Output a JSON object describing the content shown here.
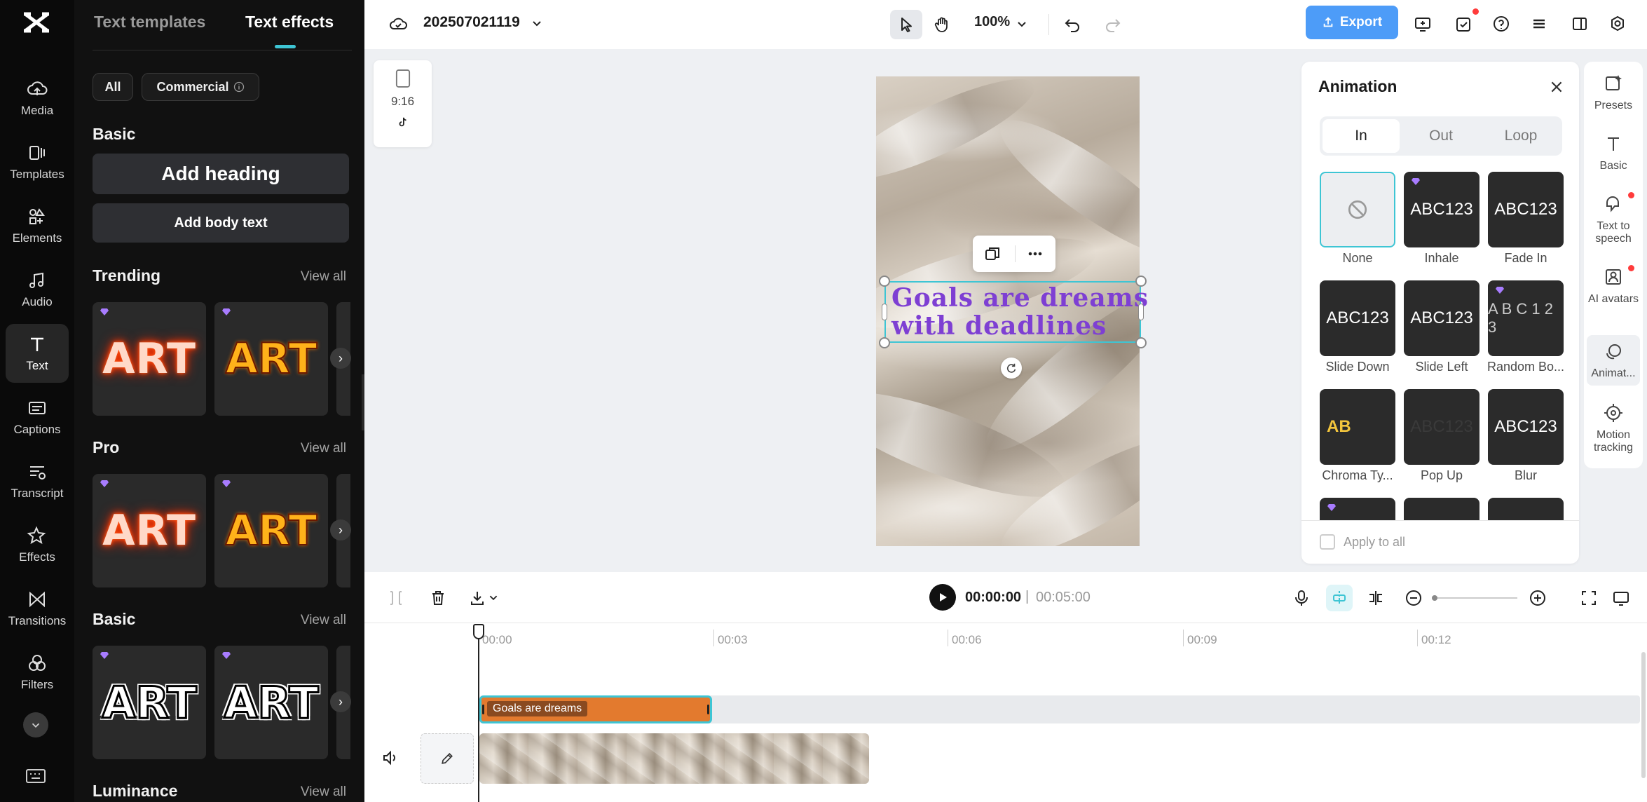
{
  "rail": {
    "items": [
      {
        "label": "Media",
        "icon": "cloud-upload-icon"
      },
      {
        "label": "Templates",
        "icon": "templates-icon"
      },
      {
        "label": "Elements",
        "icon": "elements-icon"
      },
      {
        "label": "Audio",
        "icon": "music-note-icon"
      },
      {
        "label": "Text",
        "icon": "text-icon"
      },
      {
        "label": "Captions",
        "icon": "captions-icon"
      },
      {
        "label": "Transcript",
        "icon": "transcript-icon"
      },
      {
        "label": "Effects",
        "icon": "effects-icon"
      },
      {
        "label": "Transitions",
        "icon": "transitions-icon"
      },
      {
        "label": "Filters",
        "icon": "filters-icon"
      }
    ],
    "active": "Text"
  },
  "panel": {
    "tabs": [
      "Text templates",
      "Text effects"
    ],
    "active_tab": "Text effects",
    "chips": {
      "all": "All",
      "commercial": "Commercial"
    },
    "basic_title": "Basic",
    "add_heading": "Add heading",
    "add_body": "Add body text",
    "sections": [
      {
        "title": "Trending",
        "view_all": "View all"
      },
      {
        "title": "Pro",
        "view_all": "View all"
      },
      {
        "title": "Basic",
        "view_all": "View all"
      },
      {
        "title": "Luminance",
        "view_all": "View all"
      }
    ],
    "card_text": "ART"
  },
  "topbar": {
    "project_name": "202507021119",
    "zoom": "100%",
    "export_label": "Export"
  },
  "canvas": {
    "ratio": "9:16",
    "text_line1": "Goals are dreams",
    "text_line2": "with deadlines"
  },
  "animation": {
    "title": "Animation",
    "tabs": [
      "In",
      "Out",
      "Loop"
    ],
    "active_tab": "In",
    "items": [
      {
        "label": "None",
        "preview": "",
        "selected": true,
        "pro": false
      },
      {
        "label": "Inhale",
        "preview": "ABC123",
        "pro": true
      },
      {
        "label": "Fade In",
        "preview": "ABC123",
        "pro": false
      },
      {
        "label": "Slide Down",
        "preview": "ABC123",
        "pro": false
      },
      {
        "label": "Slide Left",
        "preview": "ABC123",
        "pro": false
      },
      {
        "label": "Random Bo...",
        "preview": "A B C 1 2 3",
        "pro": true
      },
      {
        "label": "Chroma Ty...",
        "preview": "AB",
        "pro": false
      },
      {
        "label": "Pop Up",
        "preview": "ABC123",
        "pro": false
      },
      {
        "label": "Blur",
        "preview": "ABC123",
        "pro": false
      }
    ],
    "apply_all": "Apply to all"
  },
  "right_rail": {
    "items": [
      {
        "label": "Presets",
        "icon": "presets-icon"
      },
      {
        "label": "Basic",
        "icon": "text-icon"
      },
      {
        "label": "Text to speech",
        "icon": "speech-icon"
      },
      {
        "label": "AI avatars",
        "icon": "avatar-icon"
      },
      {
        "label": "Animat...",
        "icon": "animation-icon"
      },
      {
        "label": "Motion tracking",
        "icon": "motion-tracking-icon"
      }
    ]
  },
  "timeline": {
    "current_time": "00:00:00",
    "separator": "|",
    "total_time": "00:05:00",
    "ruler": [
      "00:00",
      "00:03",
      "00:06",
      "00:09",
      "00:12"
    ],
    "text_clip_label": "Goals are dreams"
  },
  "colors": {
    "accent": "#3ec5d4",
    "export": "#4d9cf8",
    "text_clip": "#e37a2e",
    "goal_text": "#7e3fd3"
  }
}
